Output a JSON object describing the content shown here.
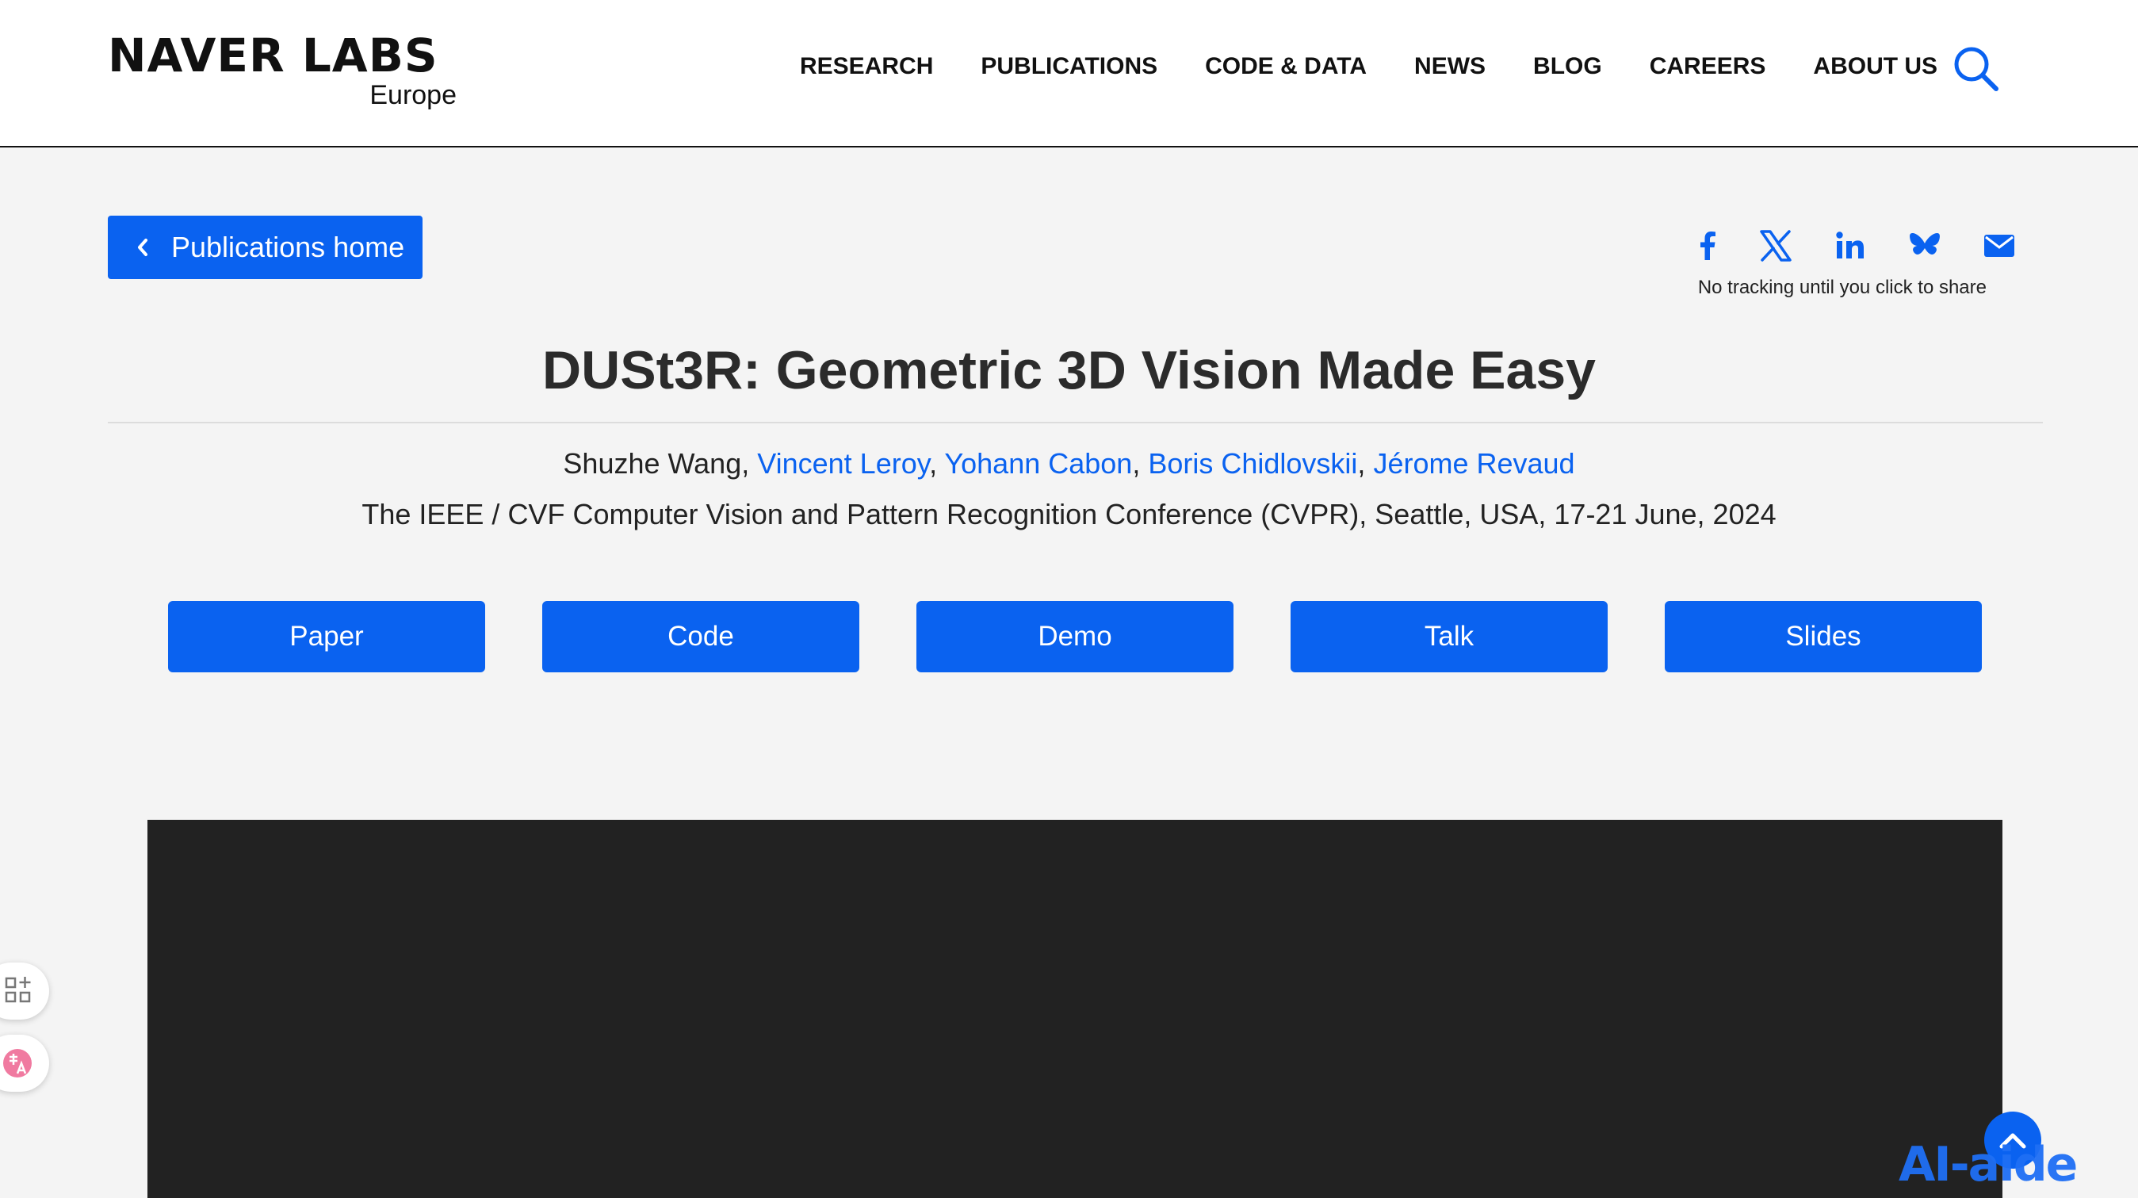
{
  "header": {
    "logo_main": "NAVER LABS",
    "logo_sub": "Europe",
    "nav": [
      "RESEARCH",
      "PUBLICATIONS",
      "CODE & DATA",
      "NEWS",
      "BLOG",
      "CAREERS",
      "ABOUT US"
    ],
    "search_icon": "search-icon"
  },
  "back_button": {
    "label": "Publications home",
    "icon": "chevron-left-icon"
  },
  "share": {
    "icons": [
      "facebook-icon",
      "x-icon",
      "linkedin-icon",
      "bluesky-icon",
      "email-icon"
    ],
    "note": "No tracking until you click to share"
  },
  "paper": {
    "title": "DUSt3R: Geometric 3D Vision Made Easy",
    "first_author": "Shuzhe Wang",
    "separator": ", ",
    "linked_authors": [
      "Vincent Leroy",
      "Yohann Cabon",
      "Boris Chidlovskii",
      "Jérome Revaud"
    ],
    "venue": "The IEEE / CVF Computer Vision and Pattern Recognition Conference (CVPR), Seattle, USA, 17-21 June, 2024"
  },
  "actions": [
    "Paper",
    "Code",
    "Demo",
    "Talk",
    "Slides"
  ],
  "watermark": "AI-aide",
  "colors": {
    "accent": "#0a62f0",
    "video_bg": "#222222",
    "page_bg": "#f4f4f4"
  }
}
